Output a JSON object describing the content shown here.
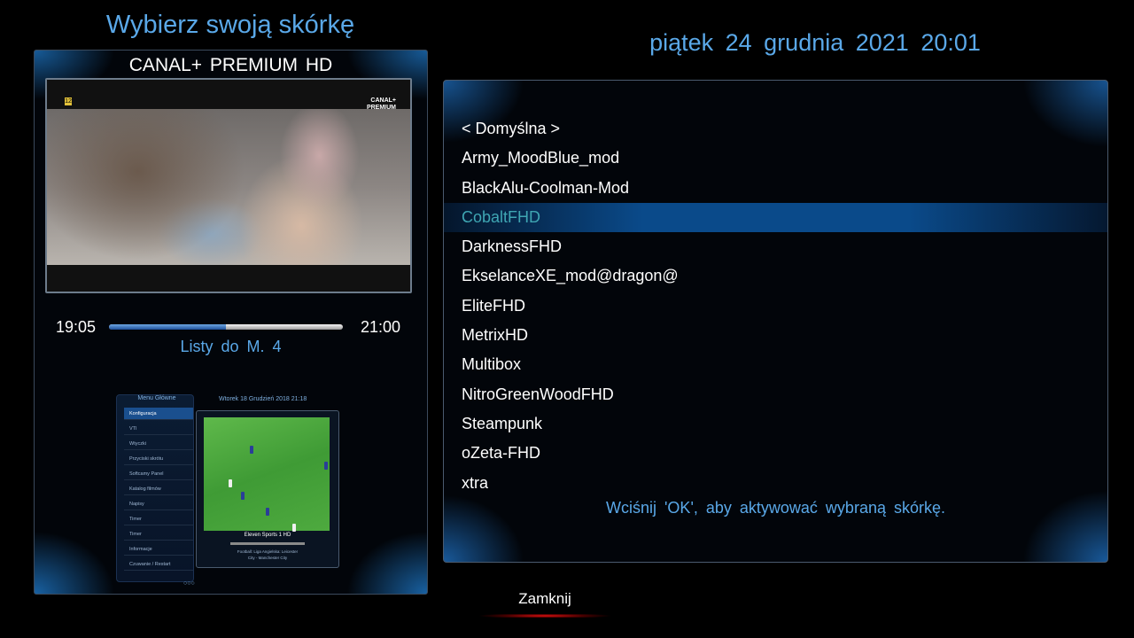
{
  "header": {
    "title": "Wybierz swoją skórkę",
    "datetime": "piątek 24 grudnia 2021   20:01"
  },
  "player": {
    "channel_name": "CANAL+ PREMIUM HD",
    "age_rating": "12",
    "logo_text": "CANAL+ PREMIUM",
    "start_time": "19:05",
    "end_time": "21:00",
    "progress_percent": 50,
    "event_title": "Listy do M. 4"
  },
  "preview": {
    "menu_title": "Menu Główne",
    "menu_items": [
      "Konfiguracja",
      "VTI",
      "Wtyczki",
      "Przyciski skrótu",
      "Softcamy Panel",
      "Katalog filmów",
      "Napisy",
      "Timer",
      "Timer",
      "Informacje",
      "Czuwanie / Restart"
    ],
    "header_text": "Wtorek 18 Grudzień 2018    21:18",
    "channel": "Eleven Sports 1 HD",
    "event_line1": "Football: Liga Angielska: Leicester",
    "event_line2": "City - Manchester City",
    "page_dots": "○○○"
  },
  "skins": {
    "items": [
      "< Domyślna >",
      "Army_MoodBlue_mod",
      "BlackAlu-Coolman-Mod",
      "CobaltFHD",
      "DarknessFHD",
      "EkselanceXE_mod@dragon@",
      "EliteFHD",
      "MetrixHD",
      "Multibox",
      "NitroGreenWoodFHD",
      "Steampunk",
      "oZeta-FHD",
      "xtra"
    ],
    "selected_index": 3,
    "hint": "Wciśnij 'OK', aby aktywować wybraną skórkę."
  },
  "footer": {
    "close_label": "Zamknij"
  },
  "colors": {
    "accent_text": "#5aa8e8",
    "selected_text": "#3fa6b3",
    "selection_bar": "#0a4a8a",
    "close_underline": "#e01010"
  }
}
